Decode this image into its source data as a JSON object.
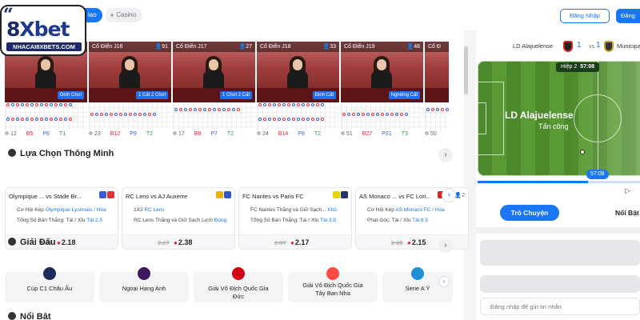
{
  "header": {
    "brand_quote": "“",
    "brand_prefix": "8",
    "brand_name": "Xbet",
    "brand_sub": "NHACAI8XBETS.COM",
    "tab_live": "iao",
    "tab_casino": "Casino",
    "login_label": "Đăng Nhập",
    "register_label": "Đăng"
  },
  "casino_tables": [
    {
      "name": "Cổ Điển J15",
      "count": "86",
      "badge": "Đinh Chơi",
      "stats": [
        "12",
        "B5",
        "P6",
        "T1"
      ]
    },
    {
      "name": "Cổ Điển J16",
      "count": "91",
      "badge": "1 Cất 2 Chơi",
      "stats": [
        "23",
        "B12",
        "P9",
        "T2"
      ]
    },
    {
      "name": "Cổ Điển J17",
      "count": "27",
      "badge": "1 Chơi 2 Cất",
      "stats": [
        "17",
        "B8",
        "P7",
        "T2"
      ]
    },
    {
      "name": "Cổ Điển J18",
      "count": "33",
      "badge": "Đinh Cất",
      "stats": [
        "24",
        "B14",
        "P8",
        "T2"
      ]
    },
    {
      "name": "Cổ Điển J19",
      "count": "48",
      "badge": "Nghiêng Cất",
      "stats": [
        "51",
        "B27",
        "P21",
        "T3"
      ]
    },
    {
      "name": "Cổ Đ",
      "count": "",
      "badge": "",
      "stats": [
        "50"
      ]
    }
  ],
  "sections": {
    "smart_picks": "Lựa Chọn Thông Minh",
    "leagues": "Giải Đấu",
    "highlights": "Nổi Bật",
    "arrow": "›"
  },
  "smart_picks": [
    {
      "title": "Olympique ... vs Stade Br...",
      "meta": "",
      "line1_prefix": "Cơ Hội Kép ",
      "line1_blue": "Olympique Lyonnais / Hòa",
      "line2_prefix": "Tổng Số Bàn Thắng: Tài / Xỉu ",
      "line2_blue": "Tài 2.5",
      "old_odd": "2.06",
      "new_odd": "2.18",
      "flag1": "#3a5bd6",
      "flag2": "#d33"
    },
    {
      "title": "RC Lens vs AJ Auxerre",
      "meta": "",
      "line1_prefix": "1X2 ",
      "line1_blue": "RC Lens",
      "line2_prefix": "RC Lens Thắng và Giữ Sạch Lưới ",
      "line2_blue": "Đúng",
      "old_odd": "2.27",
      "new_odd": "2.38",
      "flag1": "#e8b400",
      "flag2": "#3156c9"
    },
    {
      "title": "FC Nantes vs Paris FC",
      "meta": "",
      "line1_prefix": "FC Nantes Thắng và Giữ Sạch... ",
      "line1_blue": "Khô.",
      "line2_prefix": "Tổng Số Bàn Thắng: Tài / Xỉu ",
      "line2_blue": "Tài 3.5",
      "old_odd": "2.07",
      "new_odd": "2.17",
      "flag1": "#e7d600",
      "flag2": "#24346e"
    },
    {
      "title": "AS Monaco ... vs FC Lori...",
      "meta": "2",
      "line1_prefix": "Cơ Hội Kép ",
      "line1_blue": "AS Monaco FC / Hòa",
      "line2_prefix": "Phạt Góc: Tài / Xỉu ",
      "line2_blue": "Tài 8.5",
      "old_odd": "2.05",
      "new_odd": "2.15",
      "flag1": "#d22",
      "flag2": "#f28c28"
    }
  ],
  "leagues": [
    {
      "name": "Cúp C1 Châu Âu",
      "color": "#1c2a5c"
    },
    {
      "name": "Ngoại Hạng Anh",
      "color": "#3d195b"
    },
    {
      "name": "Giải Vô Địch Quốc Gia Đức",
      "color": "#d20515"
    },
    {
      "name": "Giải Vô Địch Quốc Gia Tây Ban Nha",
      "color": "#ff4b44"
    },
    {
      "name": "Serie A Ý",
      "color": "#1e90d8"
    }
  ],
  "nav_icons": {
    "chevron_right": "›",
    "play": "▷",
    "drop": "●"
  },
  "live_match": {
    "team_home": "LD Alajuelense",
    "score_home": "1",
    "vs": "vs",
    "score_away": "1",
    "team_away": "Municipal Libe",
    "half_label": "Hiệp 2",
    "half_time": "57:08",
    "attacking_team": "LD Alajuelense",
    "attack_status": "Tấn công",
    "timeline_time": "57:08",
    "progress": 0.68,
    "pitch_green": "#4c8a2b",
    "accent": "#1976f5"
  },
  "right_tabs": {
    "chat": "Trò Chuyện",
    "highlights": "Nổi Bật"
  },
  "chat": {
    "placeholder": "Đăng nhập để gửi tin nhắn"
  }
}
